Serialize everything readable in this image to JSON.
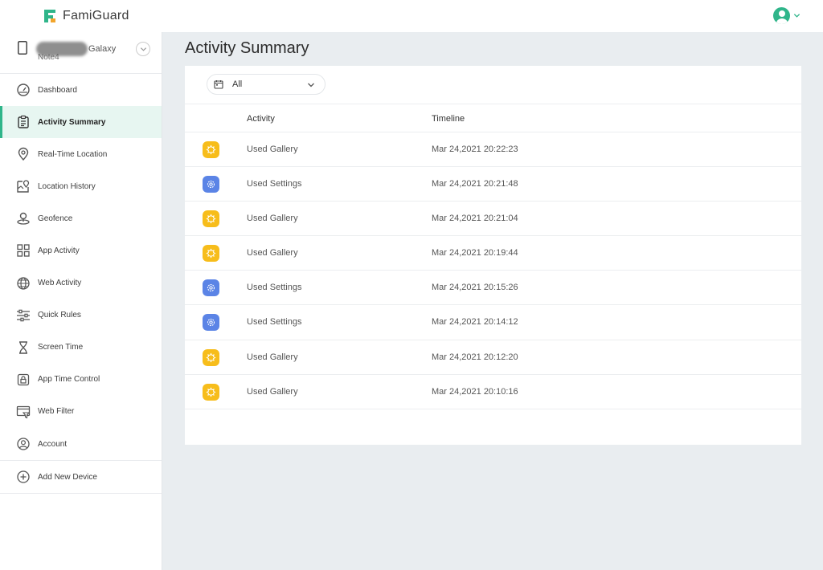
{
  "header": {
    "brand": "FamiGuard",
    "brand_color": "#2fb58a",
    "accent_color": "#f2a52b"
  },
  "device": {
    "name": "Galaxy",
    "model": "Note4"
  },
  "sidebar": {
    "items": [
      {
        "label": "Dashboard",
        "icon": "gauge-icon"
      },
      {
        "label": "Activity Summary",
        "icon": "clipboard-icon",
        "active": true
      },
      {
        "label": "Real-Time Location",
        "icon": "location-pin-icon"
      },
      {
        "label": "Location History",
        "icon": "map-pin-icon"
      },
      {
        "label": "Geofence",
        "icon": "geofence-icon"
      },
      {
        "label": "App Activity",
        "icon": "grid-icon"
      },
      {
        "label": "Web Activity",
        "icon": "globe-icon"
      },
      {
        "label": "Quick Rules",
        "icon": "sliders-icon"
      },
      {
        "label": "Screen Time",
        "icon": "hourglass-icon"
      },
      {
        "label": "App Time Control",
        "icon": "lock-icon"
      },
      {
        "label": "Web Filter",
        "icon": "web-filter-icon"
      },
      {
        "label": "Account",
        "icon": "account-icon"
      }
    ],
    "add_device": "Add New Device"
  },
  "main": {
    "title": "Activity Summary",
    "filter": {
      "selected": "All"
    },
    "columns": {
      "activity": "Activity",
      "timeline": "Timeline"
    },
    "rows": [
      {
        "app": "gallery",
        "activity": "Used Gallery",
        "time": "Mar 24,2021 20:22:23"
      },
      {
        "app": "settings",
        "activity": "Used Settings",
        "time": "Mar 24,2021 20:21:48"
      },
      {
        "app": "gallery",
        "activity": "Used Gallery",
        "time": "Mar 24,2021 20:21:04"
      },
      {
        "app": "gallery",
        "activity": "Used Gallery",
        "time": "Mar 24,2021 20:19:44"
      },
      {
        "app": "settings",
        "activity": "Used Settings",
        "time": "Mar 24,2021 20:15:26"
      },
      {
        "app": "settings",
        "activity": "Used Settings",
        "time": "Mar 24,2021 20:14:12"
      },
      {
        "app": "gallery",
        "activity": "Used Gallery",
        "time": "Mar 24,2021 20:12:20"
      },
      {
        "app": "gallery",
        "activity": "Used Gallery",
        "time": "Mar 24,2021 20:10:16"
      }
    ],
    "app_colors": {
      "gallery": "#f7bd1b",
      "settings": "#5b84e6"
    }
  }
}
